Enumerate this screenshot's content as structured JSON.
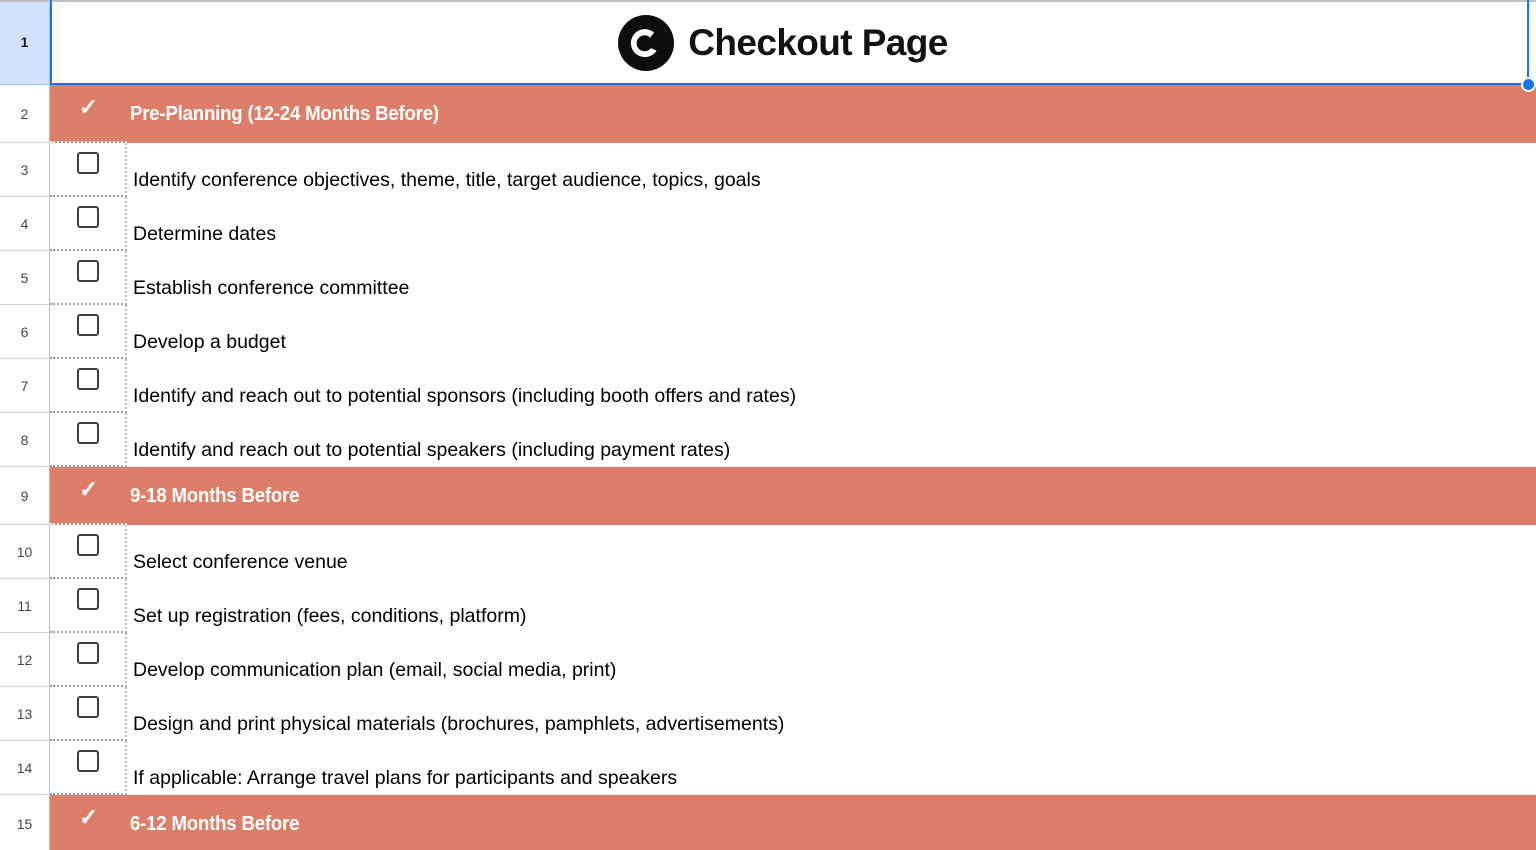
{
  "document": {
    "title": "Checkout Page",
    "logo_icon": "checkout-page-circle-logo"
  },
  "colors": {
    "section_band": "#dd7f68",
    "selection_border": "#1a73e8",
    "gutter_selected": "#d3e3fd",
    "checkbox_border": "#3c4043",
    "text": "#000000",
    "section_text": "#ffffff"
  },
  "selection": {
    "row": "1",
    "fill_handle": "fill-handle"
  },
  "rows": [
    {
      "number": "1",
      "type": "title",
      "title": "Checkout Page",
      "selected": true
    },
    {
      "number": "2",
      "type": "section",
      "tick": "✓",
      "label": "Pre-Planning (12-24 Months Before)"
    },
    {
      "number": "3",
      "type": "task",
      "checked": false,
      "label": "Identify conference objectives, theme, title, target audience, topics, goals"
    },
    {
      "number": "4",
      "type": "task",
      "checked": false,
      "label": "Determine dates"
    },
    {
      "number": "5",
      "type": "task",
      "checked": false,
      "label": "Establish conference committee"
    },
    {
      "number": "6",
      "type": "task",
      "checked": false,
      "label": "Develop a budget"
    },
    {
      "number": "7",
      "type": "task",
      "checked": false,
      "label": "Identify and reach out to potential sponsors (including booth offers and rates)"
    },
    {
      "number": "8",
      "type": "task",
      "checked": false,
      "label": "Identify and reach out to potential speakers (including payment rates)"
    },
    {
      "number": "9",
      "type": "section",
      "tick": "✓",
      "label": "9-18 Months Before"
    },
    {
      "number": "10",
      "type": "task",
      "checked": false,
      "label": "Select conference venue"
    },
    {
      "number": "11",
      "type": "task",
      "checked": false,
      "label": "Set up registration (fees, conditions, platform)"
    },
    {
      "number": "12",
      "type": "task",
      "checked": false,
      "label": "Develop communication plan (email, social media, print)"
    },
    {
      "number": "13",
      "type": "task",
      "checked": false,
      "label": "Design and print physical materials (brochures, pamphlets, advertisements)"
    },
    {
      "number": "14",
      "type": "task",
      "checked": false,
      "label": "If applicable: Arrange travel plans for participants and speakers"
    },
    {
      "number": "15",
      "type": "section",
      "tick": "✓",
      "label": "6-12 Months Before"
    }
  ]
}
